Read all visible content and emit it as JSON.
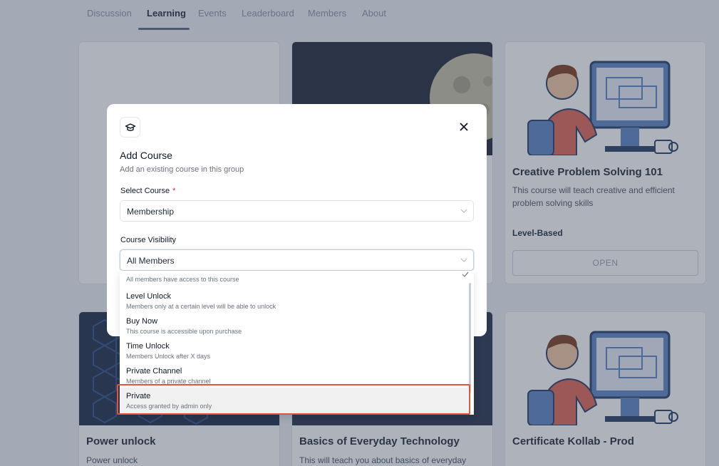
{
  "tabs": [
    "Discussion",
    "Learning",
    "Events",
    "Leaderboard",
    "Members",
    "About"
  ],
  "active_tab": "Learning",
  "cards": {
    "card3": {
      "title": "Creative Problem Solving 101",
      "desc": "This course will teach creative and efficient problem solving skills",
      "tag": "Level-Based",
      "button": "OPEN"
    },
    "card4": {
      "title": "Power unlock",
      "desc": "Power unlock"
    },
    "card5": {
      "title": "Basics of Everyday Technology",
      "desc": "This will teach you about basics of everyday"
    },
    "card6": {
      "title": "Certificate Kollab - Prod"
    }
  },
  "modal": {
    "icon": "graduation-cap-icon",
    "title": "Add Course",
    "subtitle": "Add an existing course in this group",
    "select_course": {
      "label": "Select Course",
      "required_mark": "*",
      "value": "Membership"
    },
    "visibility": {
      "label": "Course Visibility",
      "value": "All Members"
    }
  },
  "dropdown": {
    "first_desc": "All members have access to this course",
    "options": [
      {
        "label": "Level Unlock",
        "desc": "Members only at a certain level will be able to unlock"
      },
      {
        "label": "Buy Now",
        "desc": "This course is accessible upon purchase"
      },
      {
        "label": "Time Unlock",
        "desc": "Members Unlock after X days"
      },
      {
        "label": "Private Channel",
        "desc": "Members of a private channel"
      },
      {
        "label": "Private",
        "desc": "Access granted by admin only"
      }
    ]
  },
  "colors": {
    "highlight_border": "#e5533d",
    "overlay": "#3c485c",
    "accent": "#1f2937"
  }
}
